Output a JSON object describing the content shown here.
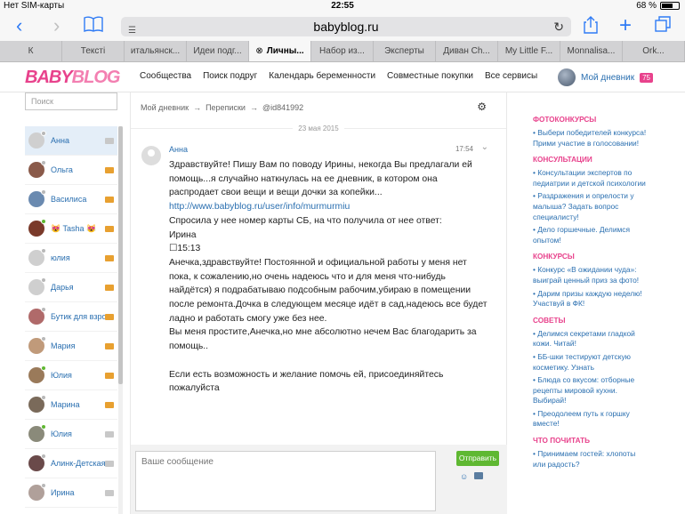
{
  "status": {
    "carrier": "Нет SIM-карты",
    "time": "22:55",
    "battery": "68 %",
    "battery_level": 0.68
  },
  "browser": {
    "url": "babyblog.ru"
  },
  "tabs": [
    {
      "label": "К",
      "active": false,
      "close": false
    },
    {
      "label": "Тексті",
      "active": false,
      "close": false
    },
    {
      "label": "итальянск...",
      "active": false,
      "close": false
    },
    {
      "label": "Идеи подг...",
      "active": false,
      "close": false
    },
    {
      "label": "Личны...",
      "active": true,
      "close": true
    },
    {
      "label": "Набор из...",
      "active": false,
      "close": false
    },
    {
      "label": "Эксперты",
      "active": false,
      "close": false
    },
    {
      "label": "Диван Ch...",
      "active": false,
      "close": false
    },
    {
      "label": "My Little F...",
      "active": false,
      "close": false
    },
    {
      "label": "Monnalisa...",
      "active": false,
      "close": false
    },
    {
      "label": "Ork...",
      "active": false,
      "close": false
    }
  ],
  "site": {
    "logo_a": "BABY",
    "logo_b": "BLOG",
    "nav": [
      "Сообщества",
      "Поиск подруг",
      "Календарь беременности",
      "Совместные покупки",
      "Все сервисы"
    ],
    "my_diary": "Мой дневник",
    "my_diary_count": "75"
  },
  "search": {
    "placeholder": "Поиск"
  },
  "contacts": [
    {
      "name": "Анна",
      "active": true,
      "online": false,
      "unread": false,
      "avatar": "#cfcfcf"
    },
    {
      "name": "Ольга",
      "active": false,
      "online": false,
      "unread": true,
      "avatar": "#8a5a4a"
    },
    {
      "name": "Василиса",
      "active": false,
      "online": false,
      "unread": true,
      "avatar": "#6a8ab0"
    },
    {
      "name": "😻 Tasha 😻",
      "active": false,
      "online": true,
      "unread": true,
      "avatar": "#7a3a2a"
    },
    {
      "name": "юлия",
      "active": false,
      "online": false,
      "unread": true,
      "avatar": "#cfcfcf"
    },
    {
      "name": "Дарья",
      "active": false,
      "online": false,
      "unread": true,
      "avatar": "#cfcfcf"
    },
    {
      "name": "Бутик для взрос",
      "active": false,
      "online": false,
      "unread": true,
      "avatar": "#b06a6a"
    },
    {
      "name": "Мария",
      "active": false,
      "online": false,
      "unread": true,
      "avatar": "#c09a7a"
    },
    {
      "name": "Юлия",
      "active": false,
      "online": true,
      "unread": true,
      "avatar": "#9a7a5a"
    },
    {
      "name": "Марина",
      "active": false,
      "online": false,
      "unread": true,
      "avatar": "#7a6a5a"
    },
    {
      "name": "Юлия",
      "active": false,
      "online": true,
      "unread": false,
      "avatar": "#8a8a7a"
    },
    {
      "name": "Алинк-Детская",
      "active": false,
      "online": false,
      "unread": false,
      "avatar": "#6a4a4a"
    },
    {
      "name": "Ирина",
      "active": false,
      "online": false,
      "unread": false,
      "avatar": "#b0a09a"
    }
  ],
  "breadcrumb": [
    "Мой дневник",
    "Переписки",
    "@id841992"
  ],
  "breadcrumb_sep": "→",
  "date": "23 мая 2015",
  "message": {
    "author": "Анна",
    "time": "17:54",
    "lines": [
      "Здравствуйте! Пишу Вам по поводу Ирины, некогда Вы предлагали ей помощь...я случайно наткнулась на ее дневник, в котором она распродает свои вещи и вещи дочки за копейки...",
      "http://www.babyblog.ru/user/info/murmurmiu",
      "Спросила у нее номер карты СБ, на что получила от нее ответ:",
      "Ирина",
      "☐15:13",
      "Анечка,здравствуйте! Постоянной и официальной работы у меня нет пока, к сожалению,но очень надеюсь что и для меня что-нибудь найдётся) я подрабатываю подсобным рабочим,убираю в помещении после ремонта.Дочка в следующем месяце идёт в сад,надеюсь все будет ладно и работать смогу уже без нее.",
      "Вы меня простите,Анечка,но мне абсолютно нечем Вас благодарить за помощь..",
      "",
      "Если есть возможность и желание помочь ей, присоединяйтесь пожалуйста"
    ]
  },
  "composer": {
    "placeholder": "Ваше сообщение",
    "send": "Отправить"
  },
  "sidebar": [
    {
      "title": "ФОТОКОНКУРСЫ",
      "items": [
        "• Выбери победителей конкурса! Прими участие в голосовании!"
      ]
    },
    {
      "title": "КОНСУЛЬТАЦИИ",
      "items": [
        "• Консультации экспертов по педиатрии и детской психологии",
        "• Раздражения и опрелости у малыша? Задать вопрос специалисту!",
        "• Дело горшечные. Делимся опытом!"
      ]
    },
    {
      "title": "КОНКУРСЫ",
      "items": [
        "• Конкурс «В ожидании чуда»: выиграй ценный приз за фото!",
        "• Дарим призы каждую неделю! Участвуй в ФК!"
      ]
    },
    {
      "title": "СОВЕТЫ",
      "items": [
        "• Делимся секретами гладкой кожи. Читай!",
        "• ББ-шки тестируют детскую косметику. Узнать",
        "• Блюда со вкусом: отборные рецепты мировой кухни. Выбирай!",
        "• Преодолеем путь к горшку вместе!"
      ]
    },
    {
      "title": "ЧТО ПОЧИТАТЬ",
      "items": [
        "• Принимаем гостей: хлопоты или радость?"
      ]
    }
  ]
}
